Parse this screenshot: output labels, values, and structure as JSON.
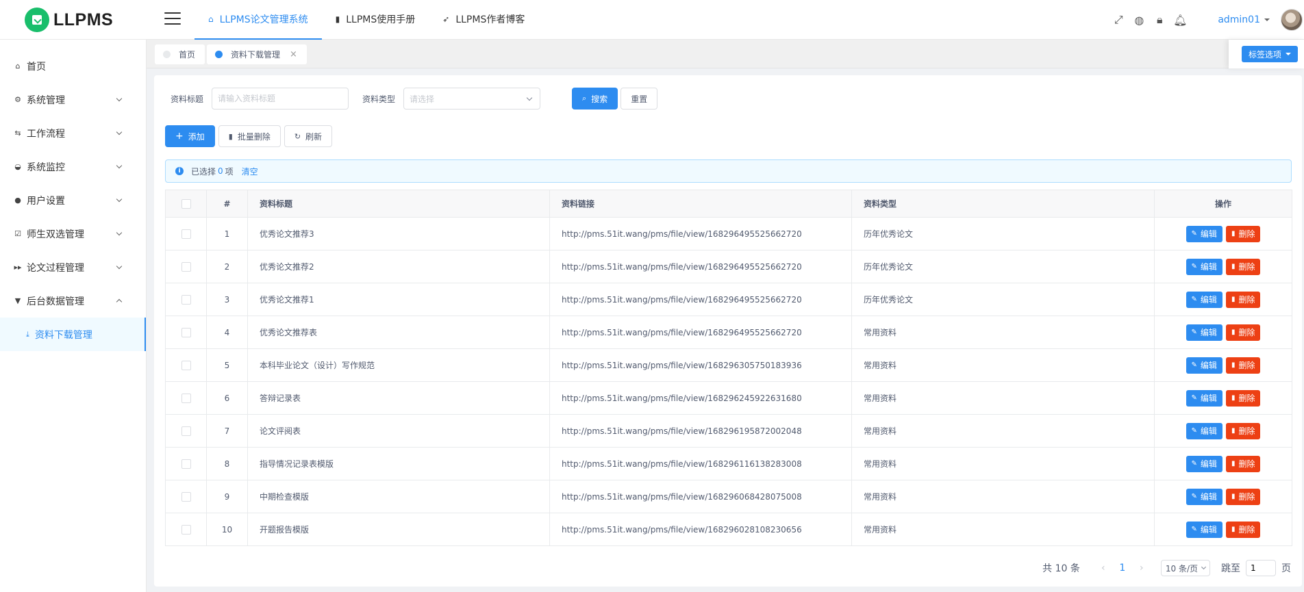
{
  "app": {
    "logo_text": "LLPMS",
    "topnav": [
      {
        "label": "LLPMS论文管理系统",
        "icon": "home-icon",
        "active": true
      },
      {
        "label": "LLPMS使用手册",
        "icon": "document-icon",
        "active": false
      },
      {
        "label": "LLPMS作者博客",
        "icon": "paper-plane-icon",
        "active": false
      }
    ],
    "user": "admin01"
  },
  "sidebar": {
    "items": [
      {
        "label": "首页",
        "icon": "home-icon",
        "symbol": "⌂"
      },
      {
        "label": "系统管理",
        "icon": "gear-icon",
        "symbol": "⚙"
      },
      {
        "label": "工作流程",
        "icon": "workflow-icon",
        "symbol": "⇆"
      },
      {
        "label": "系统监控",
        "icon": "monitor-icon",
        "symbol": "◒"
      },
      {
        "label": "用户设置",
        "icon": "user-icon",
        "symbol": "●"
      },
      {
        "label": "师生双选管理",
        "icon": "checkbox-icon",
        "symbol": "☑"
      },
      {
        "label": "论文过程管理",
        "icon": "fast-forward-icon",
        "symbol": "▸▸"
      },
      {
        "label": "后台数据管理",
        "icon": "filter-icon",
        "symbol": "▼"
      }
    ],
    "sub_item": {
      "label": "资料下载管理",
      "icon": "download-icon",
      "symbol": "⤓"
    }
  },
  "tags": {
    "items": [
      {
        "label": "首页"
      },
      {
        "label": "资料下载管理"
      }
    ],
    "options_label": "标签选项"
  },
  "filters": {
    "title_label": "资料标题",
    "title_placeholder": "请输入资料标题",
    "type_label": "资料类型",
    "type_placeholder": "请选择",
    "search_label": "搜索",
    "reset_label": "重置"
  },
  "actions": {
    "add_label": "添加",
    "batch_delete_label": "批量删除",
    "refresh_label": "刷新"
  },
  "selection": {
    "prefix": "已选择",
    "count": "0",
    "suffix": "项",
    "clear_label": "清空"
  },
  "table": {
    "columns": [
      "#",
      "资料标题",
      "资料链接",
      "资料类型",
      "操作"
    ],
    "edit_label": "编辑",
    "delete_label": "删除",
    "rows": [
      {
        "no": "1",
        "title": "优秀论文推荐3",
        "link": "http://pms.51it.wang/pms/file/view/168296495525662720",
        "type": "历年优秀论文"
      },
      {
        "no": "2",
        "title": "优秀论文推荐2",
        "link": "http://pms.51it.wang/pms/file/view/168296495525662720",
        "type": "历年优秀论文"
      },
      {
        "no": "3",
        "title": "优秀论文推荐1",
        "link": "http://pms.51it.wang/pms/file/view/168296495525662720",
        "type": "历年优秀论文"
      },
      {
        "no": "4",
        "title": "优秀论文推荐表",
        "link": "http://pms.51it.wang/pms/file/view/168296495525662720",
        "type": "常用资料"
      },
      {
        "no": "5",
        "title": "本科毕业论文（设计）写作规范",
        "link": "http://pms.51it.wang/pms/file/view/168296305750183936",
        "type": "常用资料"
      },
      {
        "no": "6",
        "title": "答辩记录表",
        "link": "http://pms.51it.wang/pms/file/view/168296245922631680",
        "type": "常用资料"
      },
      {
        "no": "7",
        "title": "论文评阅表",
        "link": "http://pms.51it.wang/pms/file/view/168296195872002048",
        "type": "常用资料"
      },
      {
        "no": "8",
        "title": "指导情况记录表模版",
        "link": "http://pms.51it.wang/pms/file/view/168296116138283008",
        "type": "常用资料"
      },
      {
        "no": "9",
        "title": "中期检查模版",
        "link": "http://pms.51it.wang/pms/file/view/168296068428075008",
        "type": "常用资料"
      },
      {
        "no": "10",
        "title": "开题报告模版",
        "link": "http://pms.51it.wang/pms/file/view/168296028108230656",
        "type": "常用资料"
      }
    ]
  },
  "pagination": {
    "total_label": "共 10 条",
    "current_page": "1",
    "page_size": "10 条/页",
    "jump_label": "跳至",
    "jump_value": "1",
    "page_suffix": "页"
  }
}
